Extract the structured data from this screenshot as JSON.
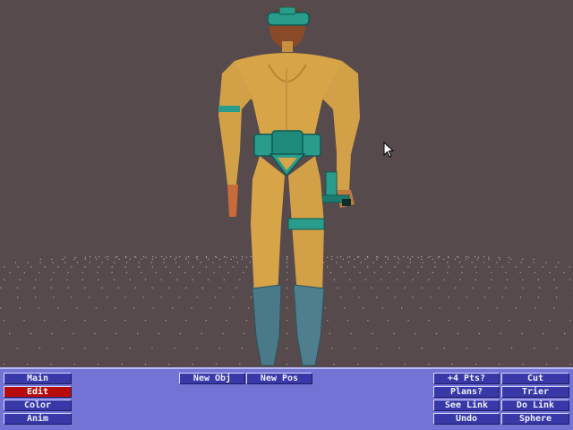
{
  "left_menu": [
    {
      "label": "Main",
      "active": false
    },
    {
      "label": "Edit",
      "active": true
    },
    {
      "label": "Color",
      "active": false
    },
    {
      "label": "Anim",
      "active": false
    }
  ],
  "object_buttons": {
    "new_obj": "New Obj",
    "new_pos": "New Pos"
  },
  "tools": {
    "pts": "+4 Pts?",
    "cut": "Cut",
    "plans": "Plans?",
    "trier": "Trier",
    "see_link": "See Link",
    "do_link": "Do Link",
    "undo": "Undo",
    "sphere": "Sphere"
  },
  "colors": {
    "background": "#574a4c",
    "panel": "#7373d6",
    "button": "#3838a8",
    "active_button": "#b80c0c",
    "skin": "#d8a448",
    "equipment": "#2a9c8c",
    "boots": "#4a7a88"
  }
}
